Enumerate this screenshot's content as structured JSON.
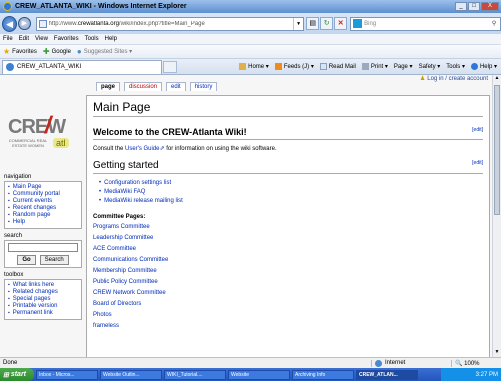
{
  "window": {
    "title": "CREW_ATLANTA_WIKI - Windows Internet Explorer",
    "min": "_",
    "max": "□",
    "close": "X"
  },
  "address": {
    "url_prefix": "http://www.",
    "url_domain": "crewatlanta.org",
    "url_rest": "/wiki/index.php?title=Main_Page",
    "search_placeholder": "Bing"
  },
  "menu": [
    "File",
    "Edit",
    "View",
    "Favorites",
    "Tools",
    "Help"
  ],
  "favorites": {
    "label": "Favorites",
    "items": [
      "Google",
      "Suggested Sites ▾"
    ]
  },
  "tab": {
    "label": "CREW_ATLANTA_WIKI"
  },
  "command_bar": [
    "Home ▾",
    "Feeds (J) ▾",
    "Read Mail",
    "Print ▾",
    "Page ▾",
    "Safety ▾",
    "Tools ▾",
    "Help ▾"
  ],
  "page": {
    "user_links": "Log in / create account",
    "logo": {
      "main": "CREW",
      "sub": "COMMERCIAL REAL ESTATE WOMEN",
      "tag": "atl"
    },
    "tabs": [
      {
        "label": "page",
        "selected": true
      },
      {
        "label": "discussion",
        "new": true
      },
      {
        "label": "edit"
      },
      {
        "label": "history"
      }
    ],
    "title": "Main Page",
    "welcome_heading": "Welcome to the CREW-Atlanta Wiki!",
    "edit_label": "[edit]",
    "intro_before": "Consult the ",
    "intro_link": "User's Guide",
    "intro_after": " for information on using the wiki software.",
    "gs_heading": "Getting started",
    "bullets": [
      "Configuration settings list",
      "MediaWiki FAQ",
      "MediaWiki release mailing list"
    ],
    "committees_title": "Committee Pages:",
    "committees": [
      "Programs Committee",
      "Leadership Committee",
      "ACE Committee",
      "Communications Committee",
      "Membership Committee",
      "Public Policy Committee",
      "CREW Network Committee",
      "Board of Directors",
      "Photos",
      "frameless"
    ]
  },
  "sidebar": {
    "navigation_title": "navigation",
    "navigation": [
      "Main Page",
      "Community portal",
      "Current events",
      "Recent changes",
      "Random page",
      "Help"
    ],
    "search_title": "search",
    "go_label": "Go",
    "search_label": "Search",
    "toolbox_title": "toolbox",
    "toolbox": [
      "What links here",
      "Related changes",
      "Special pages",
      "Printable version",
      "Permanent link"
    ]
  },
  "status": {
    "text": "Done",
    "zone": "Internet",
    "zoom": "100%"
  },
  "taskbar": {
    "start": "start",
    "items": [
      "Inbox - Micros...",
      "Website Outlin...",
      "WIKI_Tutorial....",
      "Website",
      "Archiving Info",
      "CREW_ATLAN..."
    ],
    "clock": "3:27 PM"
  }
}
